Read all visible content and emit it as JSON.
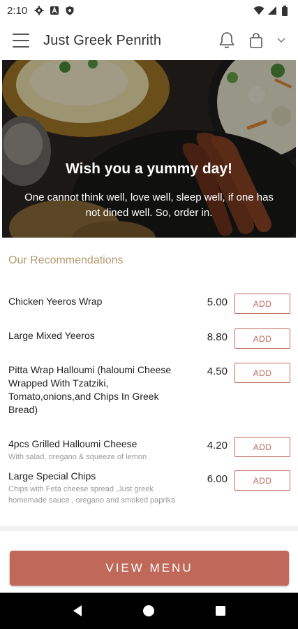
{
  "status_bar": {
    "time": "2:10",
    "icons_left": [
      "gear-icon",
      "a-icon",
      "shield-icon"
    ],
    "icons_right": [
      "wifi-icon",
      "signal-icon",
      "battery-icon"
    ]
  },
  "app_bar": {
    "title": "Just Greek Penrith",
    "icons": [
      "menu-icon",
      "bell-icon",
      "shopping-bag-icon",
      "chevron-down-icon"
    ]
  },
  "hero": {
    "title": "Wish you a yummy day!",
    "subtitle": "One cannot think well, love well, sleep well, if one has not dined well. So, order in."
  },
  "recommendations": {
    "heading": "Our Recommendations",
    "add_label": "ADD",
    "items": [
      {
        "name": "Chicken Yeeros Wrap",
        "description": "",
        "price": "5.00"
      },
      {
        "name": "Large Mixed Yeeros",
        "description": "",
        "price": "8.80"
      },
      {
        "name": "Pitta Wrap Halloumi (haloumi Cheese Wrapped With Tzatziki, Tomato,onions,and Chips In Greek Bread)",
        "description": "",
        "price": "4.50"
      },
      {
        "name": "4pcs Grilled Halloumi Cheese",
        "description": "With salad, oregano & squeeze of lemon",
        "price": "4.20"
      },
      {
        "name": "Large Special Chips",
        "description": "Chips with Feta cheese spread ,Just greek homemade sauce , oregano and smoked paprika",
        "price": "6.00"
      }
    ]
  },
  "view_menu_label": "VIEW MENU",
  "colors": {
    "accent": "#c0695a",
    "heading_gold": "#b59b6f"
  },
  "nav_bar": {
    "icons": [
      "back-icon",
      "home-icon",
      "recents-icon"
    ]
  }
}
